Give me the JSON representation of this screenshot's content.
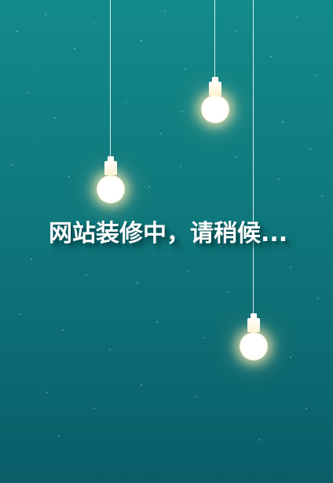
{
  "page": {
    "message": "网站装修中，请稍候..."
  },
  "icons": [
    "light-bulb-icon",
    "light-bulb-icon",
    "light-bulb-icon",
    "light-bulb-icon"
  ],
  "colors": {
    "background_top": "#138a8a",
    "background_bottom": "#0a5d68",
    "text": "#ffffff",
    "bulb_glow": "#ffe8b0"
  }
}
